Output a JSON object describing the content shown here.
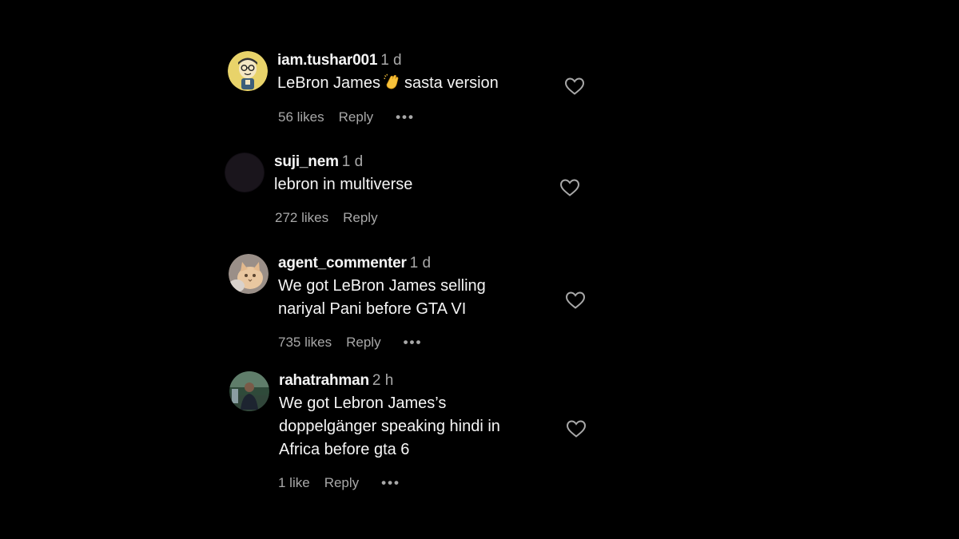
{
  "colors": {
    "background": "#000000",
    "text_primary": "#f5f5f5",
    "text_secondary": "#a8a8a8"
  },
  "comments": [
    {
      "username": "iam.tushar001",
      "time": "1 d",
      "text_parts": [
        "LeBron James",
        "sasta version"
      ],
      "emoji": "clapping-hands-icon",
      "likes": "56 likes",
      "reply": "Reply",
      "more": "•••",
      "avatar_icon": "cartoon-avatar-icon"
    },
    {
      "username": "suji_nem",
      "time": "1 d",
      "text_lines": [
        "lebron in multiverse"
      ],
      "likes": "272 likes",
      "reply": "Reply",
      "avatar_icon": "dark-avatar-icon"
    },
    {
      "username": "agent_commenter",
      "time": "1 d",
      "text_lines": [
        "We got LeBron James selling",
        "nariyal Pani before GTA VI"
      ],
      "likes": "735 likes",
      "reply": "Reply",
      "more": "•••",
      "avatar_icon": "cat-avatar-icon"
    },
    {
      "username": "rahatrahman",
      "time": "2 h",
      "text_lines": [
        "We got Lebron James’s",
        "doppelgänger speaking hindi in",
        "Africa before gta 6"
      ],
      "likes": "1 like",
      "reply": "Reply",
      "more": "•••",
      "avatar_icon": "photo-avatar-icon"
    }
  ]
}
